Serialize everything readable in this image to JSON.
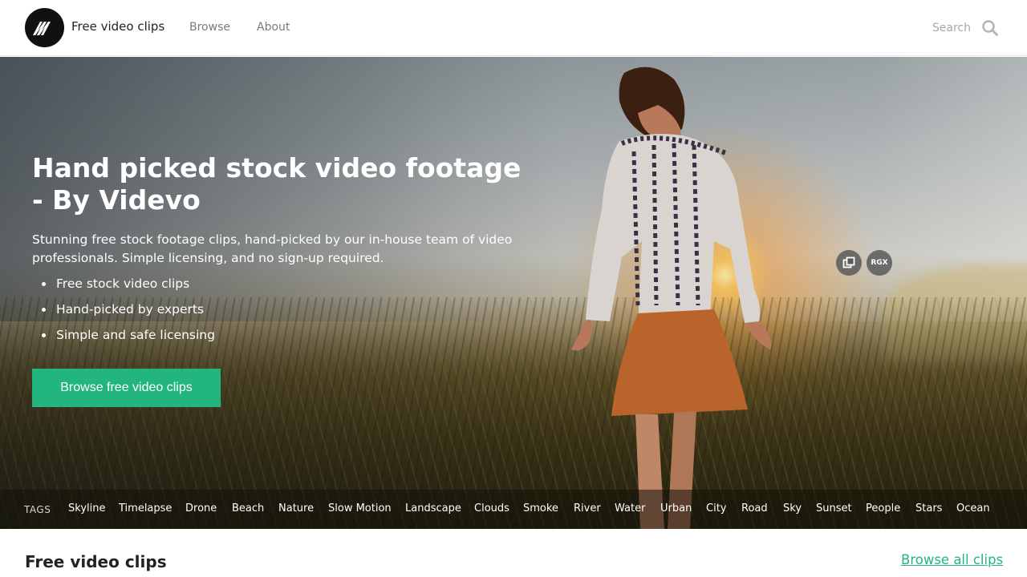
{
  "header": {
    "brand": "Free video clips",
    "nav": {
      "browse": "Browse",
      "about": "About"
    },
    "search": {
      "placeholder": "Search"
    }
  },
  "hero": {
    "title": "Hand picked stock video footage - By Videvo",
    "subtitle": "Stunning free stock footage clips, hand-picked by our in-house team of video professionals. Simple licensing, and no sign-up required.",
    "bullets": [
      "Free stock video clips",
      "Hand-picked by experts",
      "Simple and safe licensing"
    ],
    "cta_label": "Browse free video clips",
    "badge_rgx": "RGX"
  },
  "tags": {
    "label": "TAGS",
    "items": [
      "Skyline",
      "Timelapse",
      "Drone",
      "Beach",
      "Nature",
      "Slow Motion",
      "Landscape",
      "Clouds",
      "Smoke",
      "River",
      "Water",
      "Urban",
      "City",
      "Road",
      "Sky",
      "Sunset",
      "People",
      "Stars",
      "Ocean"
    ]
  },
  "section": {
    "title": "Free video clips",
    "browse_all": "Browse all clips"
  },
  "colors": {
    "accent": "#23b57e",
    "logo_bg": "#111111"
  },
  "icons": {
    "logo": "videvo-logo-icon",
    "search": "search-icon",
    "copy": "copy-icon"
  }
}
